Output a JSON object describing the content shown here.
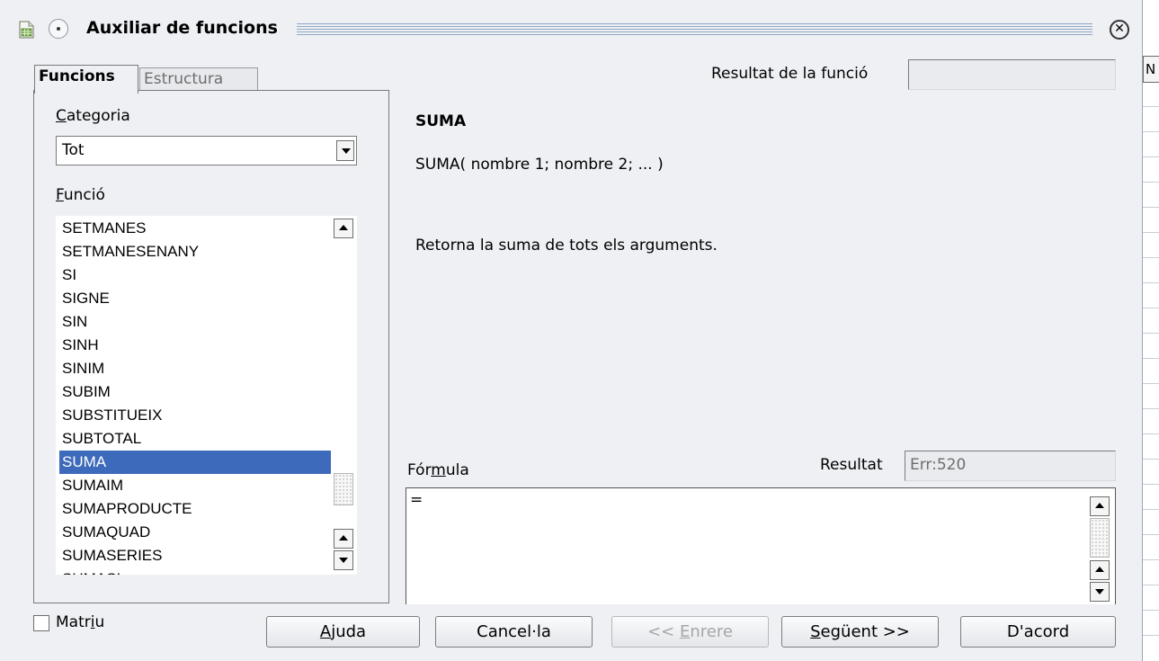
{
  "window": {
    "title": "Auxiliar de funcions",
    "app_icon": "spreadsheet-icon",
    "menu_icon": "window-menu-icon",
    "close_icon": "close-icon"
  },
  "background_sheet": {
    "column_header": "N"
  },
  "tabs": [
    {
      "label": "Funcions",
      "active": true
    },
    {
      "label": "Estructura",
      "active": false
    }
  ],
  "category": {
    "label_mnemonic": "C",
    "label_rest": "ategoria",
    "value": "Tot"
  },
  "function_list": {
    "label_mnemonic": "F",
    "label_rest": "unció",
    "items": [
      "SETMANES",
      "SETMANESENANY",
      "SI",
      "SIGNE",
      "SIN",
      "SINH",
      "SINIM",
      "SUBIM",
      "SUBSTITUEIX",
      "SUBTOTAL",
      "SUMA",
      "SUMAIM",
      "SUMAPRODUCTE",
      "SUMAQUAD",
      "SUMASERIES",
      "SUMASI"
    ],
    "selected": "SUMA"
  },
  "function_result": {
    "label": "Resultat de la funció",
    "value": ""
  },
  "function_info": {
    "name": "SUMA",
    "syntax": "SUMA( nombre 1; nombre 2; ... )",
    "description": "Retorna la suma de tots els arguments."
  },
  "formula": {
    "label_pre": "Fór",
    "label_mnemonic": "m",
    "label_post": "ula",
    "value": "=",
    "result_label": "Resultat",
    "result_value": "Err:520"
  },
  "matrix": {
    "label_pre": "Matr",
    "label_mnemonic": "i",
    "label_post": "u",
    "checked": false
  },
  "buttons": {
    "help": {
      "mnemonic": "A",
      "rest": "juda"
    },
    "cancel": {
      "label": "Cancel·la"
    },
    "back": {
      "pre": "<< ",
      "mnemonic": "E",
      "rest": "nrere",
      "enabled": false
    },
    "next": {
      "mnemonic": "S",
      "rest": "egüent >>"
    },
    "ok": {
      "label": "D'acord"
    }
  },
  "colors": {
    "selection": "#3d6aba",
    "dialog_bg": "#eef0f4",
    "title_lines": "#8fa4c4"
  }
}
